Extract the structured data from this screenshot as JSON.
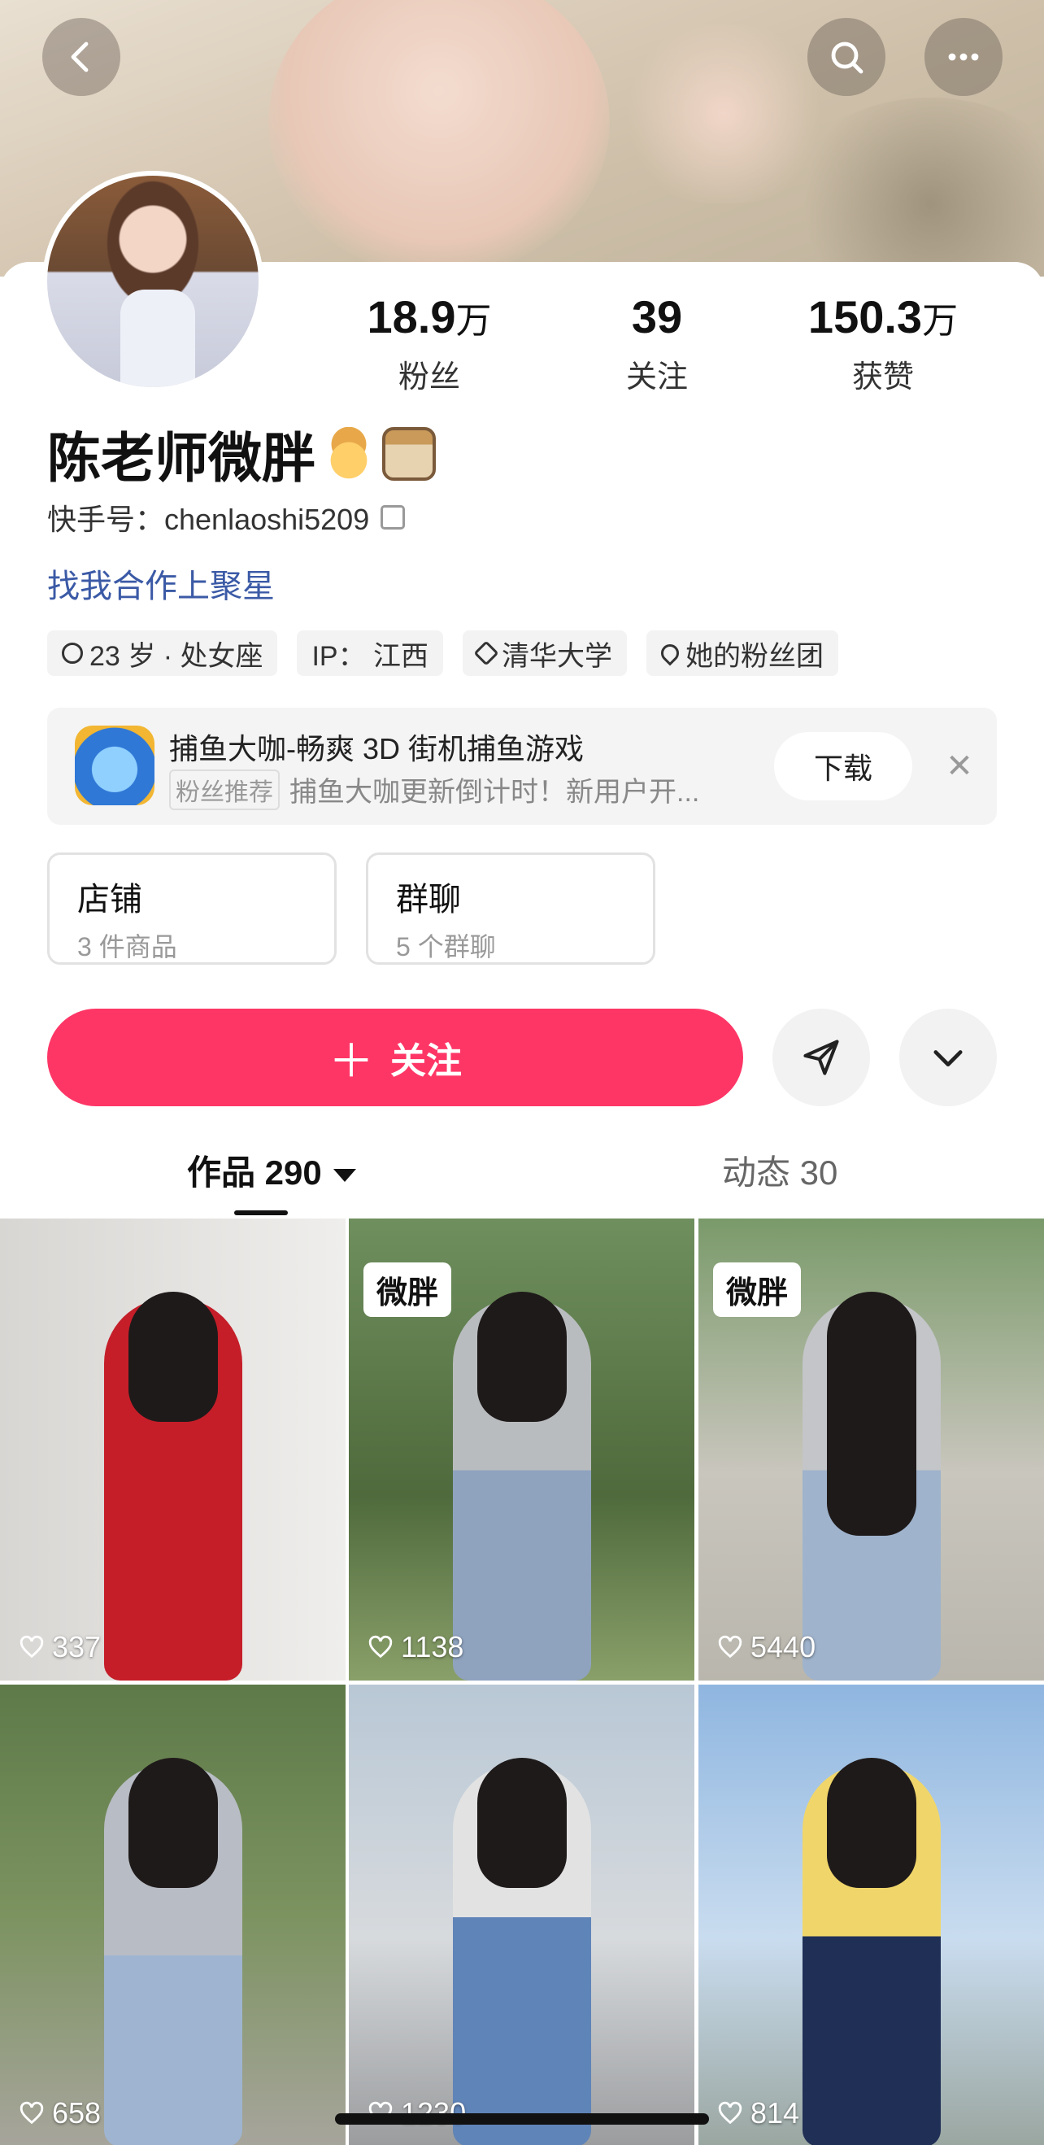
{
  "profile": {
    "name": "陈老师微胖",
    "kuaishou_id": "快手号：chenlaoshi5209",
    "cooperation_link": "找我合作上聚星"
  },
  "stats": [
    {
      "value": "18.9",
      "unit": "万",
      "label": "粉丝"
    },
    {
      "value": "39",
      "unit": "",
      "label": "关注"
    },
    {
      "value": "150.3",
      "unit": "万",
      "label": "获赞"
    }
  ],
  "tags": [
    {
      "icon": "pin-icon",
      "text": "23 岁 · 处女座"
    },
    {
      "icon": "",
      "text": "IP： 江西"
    },
    {
      "icon": "graduation-cap-icon",
      "text": "清华大学"
    },
    {
      "icon": "heart-icon",
      "text": "她的粉丝团"
    }
  ],
  "ad": {
    "title": "捕鱼大咖-畅爽 3D 街机捕鱼游戏",
    "badge": "粉丝推荐",
    "desc": "捕鱼大咖更新倒计时！新用户开...",
    "download_label": "下载",
    "close_label": "✕"
  },
  "cards": [
    {
      "title": "店铺",
      "sub": "3 件商品"
    },
    {
      "title": "群聊",
      "sub": "5 个群聊"
    }
  ],
  "actions": {
    "follow_plus": "＋",
    "follow_label": "关注"
  },
  "tabs": {
    "works": "作品 290",
    "moments": "动态 30"
  },
  "videos": [
    {
      "likes": "337",
      "label": ""
    },
    {
      "likes": "1138",
      "label": "微胖"
    },
    {
      "likes": "5440",
      "label": "微胖"
    },
    {
      "likes": "658",
      "label": ""
    },
    {
      "likes": "1230",
      "label": ""
    },
    {
      "likes": "814",
      "label": ""
    }
  ],
  "colors": {
    "follow_button": "#fe3666",
    "link": "#3b5aa6"
  }
}
